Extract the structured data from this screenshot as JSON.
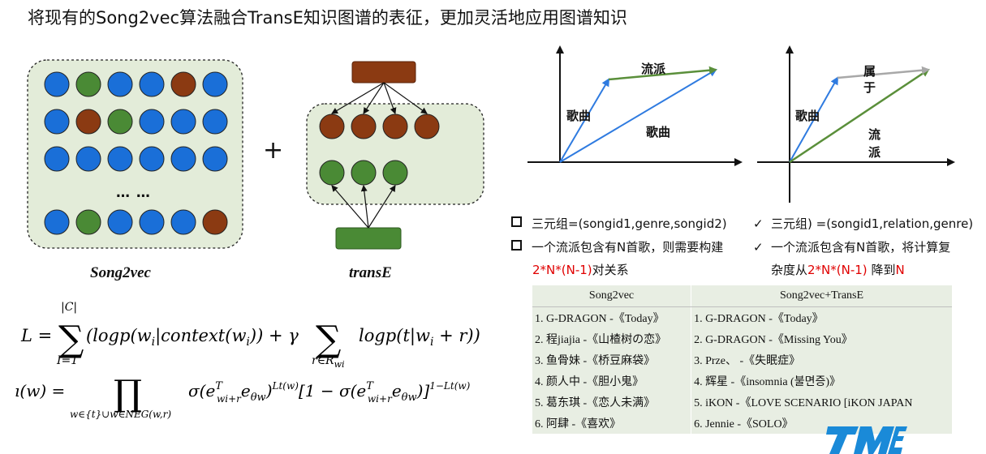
{
  "title": "将现有的Song2vec算法融合TransE知识图谱的表征，更加灵活地应用图谱知识",
  "left_diagram": {
    "song2vec_caption": "Song2vec",
    "transe_caption": "transE",
    "ellipsis": "… …",
    "plus": "+"
  },
  "vector_plot_left": {
    "label_genre": "流派",
    "label_song_a": "歌曲",
    "label_song_b": "歌曲"
  },
  "vector_plot_right": {
    "label_belongs": "属\n于",
    "label_song": "歌曲",
    "label_genre": "流\n派"
  },
  "bullets_left": {
    "item1": "三元组=(songid1,genre,songid2)",
    "item2": "一个流派包含有N首歌，则需要构建",
    "item2_cont_red": "2*N*(N-1)",
    "item2_cont": "对关系"
  },
  "bullets_right": {
    "check": "✓",
    "item1": "三元组) =(songid1,relation,genre)",
    "item2": "一个流派包含有N首歌，将计算复",
    "item2_cont_a": "杂度从",
    "item2_cont_red1": "2*N*(N-1)",
    "item2_cont_b": " 降到",
    "item2_cont_red2": "N"
  },
  "table": {
    "headers": [
      "Song2vec",
      "Song2vec+TransE"
    ],
    "rows": [
      [
        "1. G-DRAGON -《Today》",
        "1. G-DRAGON -《Today》"
      ],
      [
        "2. 程jiajia -《山楂树の恋》",
        "2. G-DRAGON -《Missing You》"
      ],
      [
        "3. 鱼骨妹 -《桥豆麻袋》",
        "3. Prze、 -《失眠症》"
      ],
      [
        "4. 颜人中 -《胆小鬼》",
        "4. 辉星 -《insomnia (불면증)》"
      ],
      [
        "5. 葛东琪 -《恋人未满》",
        "5. iKON -《LOVE SCENARIO [iKON JAPAN"
      ],
      [
        "6. 阿肆 -《喜欢》",
        "6. Jennie -《SOLO》"
      ]
    ]
  },
  "colors": {
    "blue_node": "#1a6fd8",
    "green_node": "#4a8a35",
    "brown_node": "#8b3a12",
    "panel_fill": "#e3ecd9",
    "arrow_blue": "#2f7be0",
    "arrow_green": "#5a8f3a",
    "red_text": "#e00000"
  }
}
